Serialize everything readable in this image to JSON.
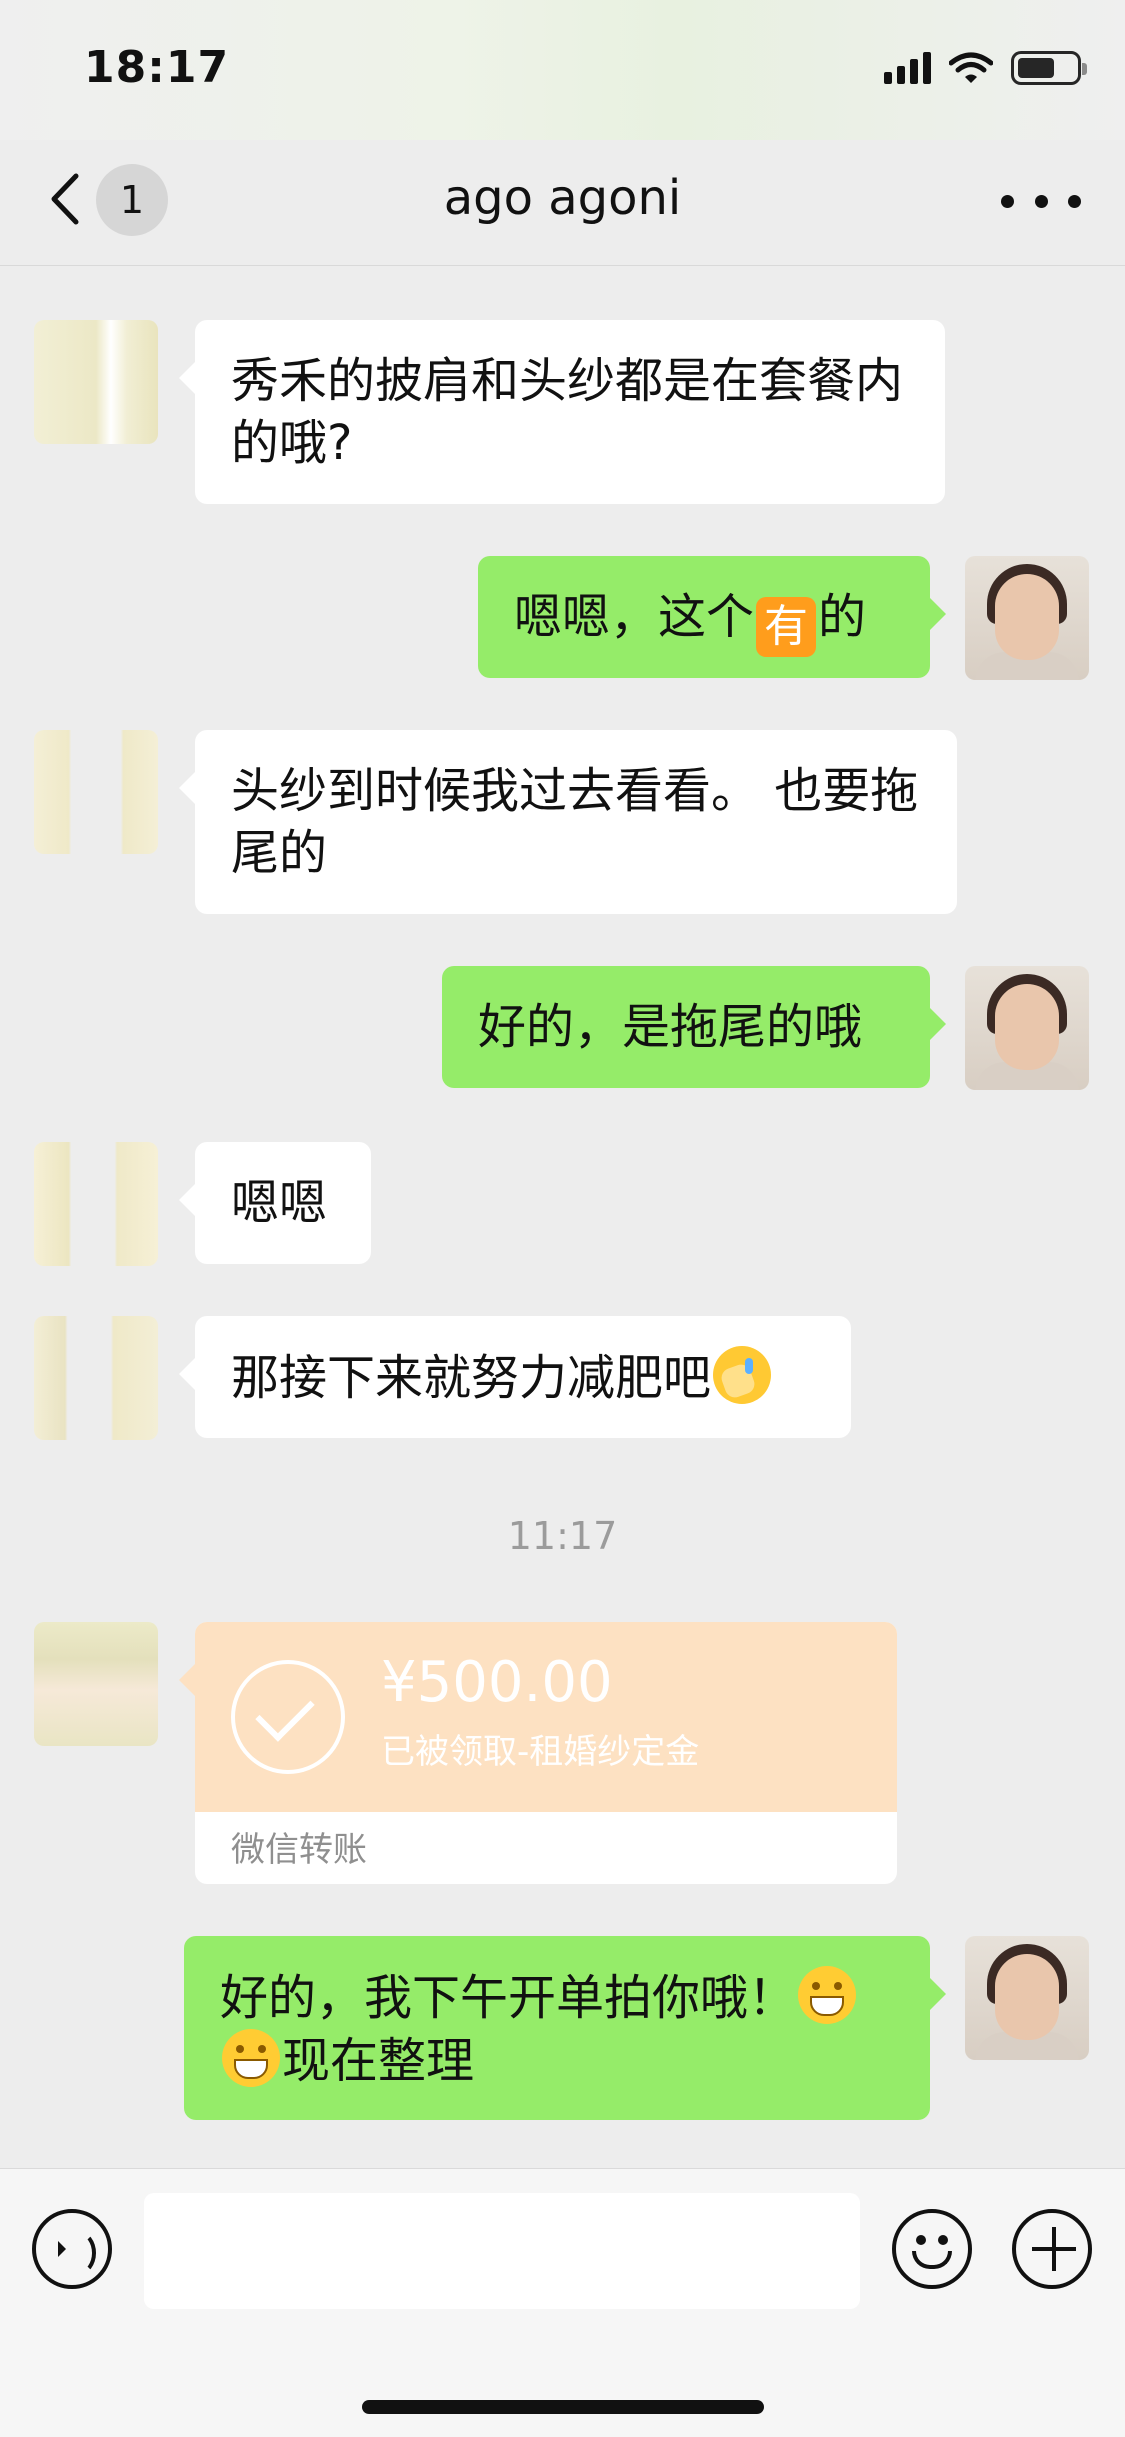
{
  "status_bar": {
    "time": "18:17"
  },
  "nav": {
    "back_count": "1",
    "title": "ago  agoni"
  },
  "messages": [
    {
      "side": "in",
      "text": "秀禾的披肩和头纱都是在套餐内的哦?"
    },
    {
      "side": "out",
      "text_before": "嗯嗯，这个",
      "emoji_char": "有",
      "text_after": "的"
    },
    {
      "side": "in",
      "text": "头纱到时候我过去看看。 也要拖尾的"
    },
    {
      "side": "out",
      "text": "好的，是拖尾的哦"
    },
    {
      "side": "in",
      "text": "嗯嗯"
    },
    {
      "side": "in",
      "text": "那接下来就努力减肥吧",
      "emoji": "facepalm-icon"
    },
    {
      "side": "out",
      "text_part1": "好的，我下午开单拍你哦！",
      "text_part2": "现在整理",
      "emoji": "grinning-face-icon"
    }
  ],
  "timestamp": "11:17",
  "transfer": {
    "amount": "¥500.00",
    "note": "已被领取-租婚纱定金",
    "footer": "微信转账"
  },
  "input": {
    "placeholder": ""
  },
  "colors": {
    "outgoing_bubble": "#95ec69",
    "incoming_bubble": "#ffffff",
    "transfer": "#fde1c2",
    "background": "#ededed"
  }
}
